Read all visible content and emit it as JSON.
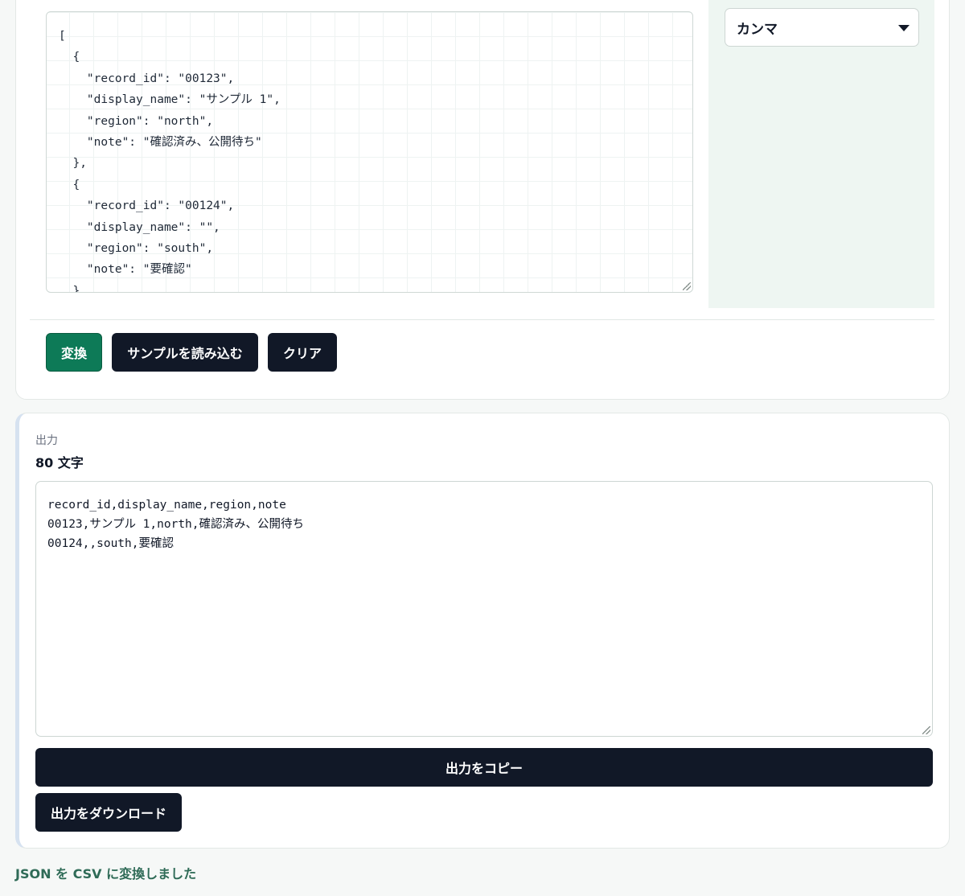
{
  "input": {
    "text": "[\n  {\n    \"record_id\": \"00123\",\n    \"display_name\": \"サンプル 1\",\n    \"region\": \"north\",\n    \"note\": \"確認済み、公開待ち\"\n  },\n  {\n    \"record_id\": \"00124\",\n    \"display_name\": \"\",\n    \"region\": \"south\",\n    \"note\": \"要確認\"\n  }\n]"
  },
  "delimiter": {
    "selected": "カンマ"
  },
  "actions": {
    "convert_label": "変換",
    "sample_label": "サンプルを読み込む",
    "clear_label": "クリア"
  },
  "output": {
    "label": "出力",
    "count": "80 文字",
    "text": "record_id,display_name,region,note\n00123,サンプル 1,north,確認済み、公開待ち\n00124,,south,要確認",
    "copy_label": "出力をコピー",
    "download_label": "出力をダウンロード"
  },
  "status": "JSON を CSV に変換しました",
  "colors": {
    "accent": "#0d7a57",
    "button_dark": "#111827",
    "status_text": "#2f6b57",
    "panel_bg": "#eef6f2"
  }
}
